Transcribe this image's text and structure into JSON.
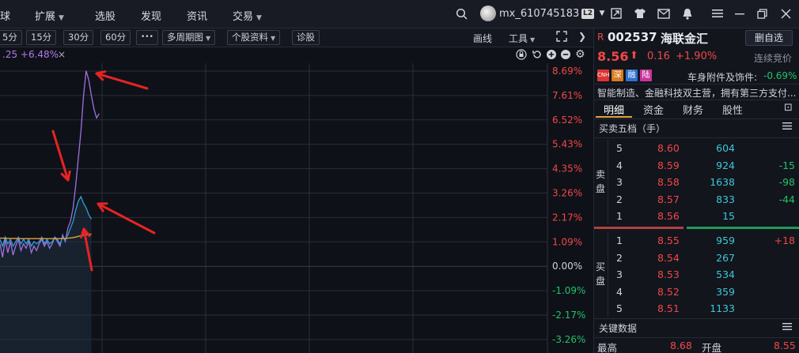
{
  "menu": {
    "item0": "球",
    "item1": "扩展",
    "item2": "选股",
    "item3": "发现",
    "item4": "资讯",
    "item5": "交易"
  },
  "user": {
    "name": "mx_610745183",
    "level_badge": "L2"
  },
  "toolbar": {
    "btn_5m": "5分",
    "btn_15m": "15分",
    "btn_30m": "30分",
    "btn_60m": "60分",
    "btn_more": "•••",
    "btn_multi": "多周期图",
    "btn_profile": "个股资料",
    "btn_diag": "诊股",
    "draw_line": "画线",
    "tools": "工具"
  },
  "chart_header": {
    "text": ".25  +6.48%",
    "close": "×"
  },
  "chart_data": {
    "type": "line",
    "y_axis_labels": [
      "8.69%",
      "7.61%",
      "6.52%",
      "5.43%",
      "4.35%",
      "3.26%",
      "2.17%",
      "1.09%",
      "0.00%",
      "-1.09%",
      "-2.17%",
      "-3.26%"
    ],
    "ylim": [
      -3.26,
      8.69
    ],
    "series": [
      {
        "color": "#a070e0",
        "values": [
          1.0,
          0.4,
          1.2,
          0.6,
          1.1,
          0.5,
          0.9,
          1.2,
          0.7,
          1.0,
          0.8,
          1.1,
          0.6,
          0.9,
          0.7,
          1.0,
          1.2,
          0.9,
          1.1,
          0.8,
          1.0,
          1.3,
          1.1,
          0.9,
          1.4,
          1.1,
          1.7,
          2.0,
          2.6,
          3.6,
          4.8,
          6.0,
          7.6,
          8.7,
          8.3,
          7.6,
          7.0,
          6.6,
          6.8
        ]
      },
      {
        "color": "#2e9fd8",
        "values": [
          1.2,
          0.9,
          1.3,
          1.0,
          1.2,
          0.9,
          1.1,
          1.3,
          1.0,
          1.2,
          1.0,
          1.2,
          0.9,
          1.1,
          1.0,
          1.1,
          1.3,
          1.0,
          1.2,
          1.0,
          1.1,
          1.3,
          1.2,
          1.0,
          1.3,
          1.2,
          1.4,
          1.7,
          2.0,
          2.5,
          2.9,
          3.1,
          2.8,
          2.6,
          2.3,
          2.1
        ]
      },
      {
        "color": "#e8a23a",
        "values": [
          1.25,
          1.25,
          1.25,
          1.24,
          1.24,
          1.24,
          1.24,
          1.23,
          1.23,
          1.23,
          1.23,
          1.23,
          1.23,
          1.23,
          1.23,
          1.23,
          1.23,
          1.23,
          1.23,
          1.23,
          1.23,
          1.23,
          1.23,
          1.23,
          1.24,
          1.24,
          1.25,
          1.26,
          1.28,
          1.3,
          1.33,
          1.36,
          1.38,
          1.4,
          1.42,
          1.43
        ]
      }
    ],
    "colors": {
      "up": "#f04848",
      "down": "#22c26a",
      "grid": "#2a2e3a",
      "arrow": "#e52424"
    }
  },
  "quote": {
    "prefix": "R",
    "code": "002537",
    "name": "海联金汇",
    "remove_btn": "删自选",
    "price": "8.56",
    "arrow": "⬆",
    "change": "0.16",
    "pct": "+1.90%",
    "status": "连续竞价",
    "tags": [
      "CNH",
      "深",
      "融",
      "陆"
    ],
    "sector": "车身附件及饰件:",
    "sector_pct": "-0.69%",
    "desc": "智能制造、金融科技双主营，拥有第三方支付..."
  },
  "tabs": [
    "明细",
    "资金",
    "财务",
    "股性"
  ],
  "orderbook": {
    "title": "买卖五档（手）",
    "sell_label_1": "卖",
    "sell_label_2": "盘",
    "buy_label_1": "买",
    "buy_label_2": "盘",
    "sell": [
      {
        "level": "5",
        "price": "8.60",
        "vol": "604",
        "chg": ""
      },
      {
        "level": "4",
        "price": "8.59",
        "vol": "924",
        "chg": "-15"
      },
      {
        "level": "3",
        "price": "8.58",
        "vol": "1638",
        "chg": "-98"
      },
      {
        "level": "2",
        "price": "8.57",
        "vol": "833",
        "chg": "-44"
      },
      {
        "level": "1",
        "price": "8.56",
        "vol": "15",
        "chg": ""
      }
    ],
    "buy": [
      {
        "level": "1",
        "price": "8.55",
        "vol": "959",
        "chg": "+18"
      },
      {
        "level": "2",
        "price": "8.54",
        "vol": "267",
        "chg": ""
      },
      {
        "level": "3",
        "price": "8.53",
        "vol": "534",
        "chg": ""
      },
      {
        "level": "4",
        "price": "8.52",
        "vol": "359",
        "chg": ""
      },
      {
        "level": "5",
        "price": "8.51",
        "vol": "1133",
        "chg": ""
      }
    ]
  },
  "key_data": {
    "title": "关键数据",
    "high_label": "最高",
    "high_val": "8.68",
    "open_label": "开盘",
    "open_val": "8.55"
  }
}
